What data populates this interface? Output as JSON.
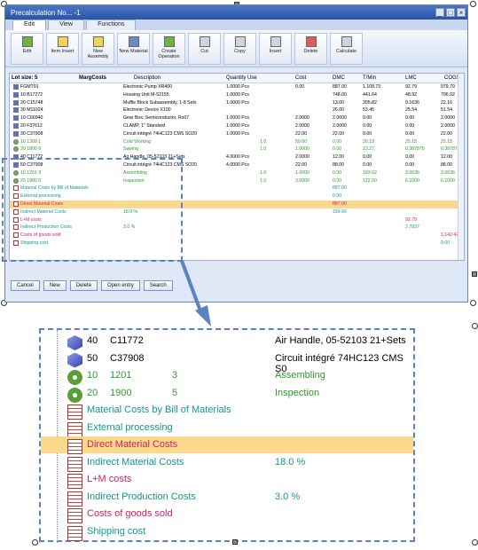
{
  "window": {
    "title": "Precalculation No... -1",
    "controls": [
      "_",
      "□",
      "×"
    ]
  },
  "tabs": [
    "Edit",
    "View",
    "Functions"
  ],
  "ribbon": [
    {
      "label": "Edit",
      "icon": "edit-icon"
    },
    {
      "label": "Item Insert",
      "icon": "item-insert-icon"
    },
    {
      "label": "New Assembly",
      "icon": "new-assembly-icon"
    },
    {
      "label": "New Material",
      "icon": "new-material-icon"
    },
    {
      "label": "Create Operation",
      "icon": "create-operation-icon"
    },
    {
      "label": "Cut",
      "icon": "cut-icon"
    },
    {
      "label": "Copy",
      "icon": "copy-icon"
    },
    {
      "label": "Insert",
      "icon": "insert-icon"
    },
    {
      "label": "Delete",
      "icon": "delete-icon"
    },
    {
      "label": "Calculate",
      "icon": "calculate-icon"
    }
  ],
  "grid": {
    "lot_size": "Lot size: 5",
    "marg_costs": "MargCosts",
    "headers": [
      "Description",
      "Quantity Use",
      "Cost",
      "DMC",
      "T/Min",
      "LMC",
      "COGS"
    ],
    "rows": [
      {
        "tree": "FGMT01",
        "desc": "Electronic Pump XR400",
        "qty": "1.0000 Pcs",
        "use": "",
        "cost": "0.00",
        "dmc": "887.00",
        "tmin": "1,108.73",
        "lmc": "92.79",
        "cogs": "979.79",
        "cls": "",
        "icon": "cube"
      },
      {
        "tree": "10  B17272",
        "desc": "Housing Unit M-52155",
        "qty": "1.0000 Pcs",
        "use": "",
        "cost": "",
        "dmc": "748.00",
        "tmin": "441.64",
        "lmc": "48.92",
        "cogs": "796.92",
        "cls": "",
        "icon": "cube"
      },
      {
        "tree": "20  C15748",
        "desc": "Muffle Block Subassembly, 1-8 Sets",
        "qty": "1.0000 Pcs",
        "use": "",
        "cost": "",
        "dmc": "13.00",
        "tmin": "305.82",
        "lmc": "9.1636",
        "cogs": "22.16",
        "cls": "",
        "icon": "cube"
      },
      {
        "tree": "30  M11024",
        "desc": "Electronic Device X100",
        "qty": "",
        "use": "",
        "cost": "",
        "dmc": "26.00",
        "tmin": "53.45",
        "lmc": "25.54",
        "cogs": "51.54",
        "cls": "",
        "icon": "cube"
      },
      {
        "tree": "10  C66940",
        "desc": "Gear Box, Semiconductor, Rx07",
        "qty": "1.0000 Pcs",
        "use": "",
        "cost": "2.0000",
        "dmc": "2.0000",
        "tmin": "0.00",
        "lmc": "0.00",
        "cogs": "2.0000",
        "cls": "",
        "icon": "cube"
      },
      {
        "tree": "20  F37612",
        "desc": "CLAMP, 1\" Standard",
        "qty": "1.0000 Pcs",
        "use": "",
        "cost": "2.0000",
        "dmc": "2.0000",
        "tmin": "0.00",
        "lmc": "0.00",
        "cogs": "2.0000",
        "cls": "",
        "icon": "cube"
      },
      {
        "tree": "30  C37908",
        "desc": "Circuit intégré 74HC123 CMS SO20",
        "qty": "1.0000 Pcs",
        "use": "",
        "cost": "22.00",
        "dmc": "22.00",
        "tmin": "0.00",
        "lmc": "0.00",
        "cogs": "22.00",
        "cls": "",
        "icon": "cube"
      },
      {
        "tree": "10  1300       1",
        "desc": "Cold Working",
        "qty": "",
        "use": "1.0",
        "cost": "50.00",
        "dmc": "0.00",
        "tmin": "30.18",
        "lmc": "25.15",
        "cogs": "25.15",
        "cls": "c-green",
        "icon": "gear"
      },
      {
        "tree": "20  1800       6",
        "desc": "Sawing",
        "qty": "",
        "use": "1.0",
        "cost": "1.0000",
        "dmc": "0.00",
        "tmin": "23.27",
        "lmc": "0.387879",
        "cogs": "0.387879",
        "cls": "c-green",
        "icon": "gear"
      },
      {
        "tree": "40  C11772",
        "desc": "Air Handle, 05-52103 21+Sets",
        "qty": "4.0000 Pcs",
        "use": "",
        "cost": "2.0000",
        "dmc": "12.00",
        "tmin": "0.00",
        "lmc": "0.00",
        "cogs": "12.00",
        "cls": "",
        "icon": "cube"
      },
      {
        "tree": "50  C37908",
        "desc": "Circuit intégré 74HC123 CMS SO20",
        "qty": "4.0000 Pcs",
        "use": "",
        "cost": "22.00",
        "dmc": "88.00",
        "tmin": "0.00",
        "lmc": "0.00",
        "cogs": "88.00",
        "cls": "",
        "icon": "cube"
      },
      {
        "tree": "10  1201       3",
        "desc": "Assembling",
        "qty": "",
        "use": "1.0",
        "cost": "1.0000",
        "dmc": "0.00",
        "tmin": "183.62",
        "lmc": "3.0636",
        "cogs": "3.0636",
        "cls": "c-green",
        "icon": "gear"
      },
      {
        "tree": "20  1900       5",
        "desc": "Inspection",
        "qty": "",
        "use": "1.0",
        "cost": "3.0000",
        "dmc": "0.00",
        "tmin": "122.00",
        "lmc": "6.1000",
        "cogs": "6.1000",
        "cls": "c-green",
        "icon": "gear"
      },
      {
        "tree": "Material Costs by Bill of Materials",
        "desc": "",
        "qty": "",
        "use": "",
        "cost": "",
        "dmc": "887.00",
        "tmin": "",
        "lmc": "",
        "cogs": "",
        "cls": "c-teal",
        "icon": "doc"
      },
      {
        "tree": "External processing",
        "desc": "",
        "qty": "",
        "use": "",
        "cost": "",
        "dmc": "0.00",
        "tmin": "",
        "lmc": "",
        "cogs": "",
        "cls": "c-teal",
        "icon": "doc"
      },
      {
        "tree": "Direct Material Costs",
        "desc": "",
        "qty": "",
        "use": "",
        "cost": "",
        "dmc": "887.00",
        "tmin": "",
        "lmc": "",
        "cogs": "",
        "cls": "c-pink",
        "icon": "doc",
        "hl": true
      },
      {
        "tree": "Indirect Material Costs",
        "desc": "18.0 %",
        "qty": "",
        "use": "",
        "cost": "",
        "dmc": "159.66",
        "tmin": "",
        "lmc": "",
        "cogs": "",
        "cls": "c-teal",
        "icon": "doc"
      },
      {
        "tree": "L+M costs",
        "desc": "",
        "qty": "",
        "use": "",
        "cost": "",
        "dmc": "",
        "tmin": "",
        "lmc": "92.79",
        "cogs": "",
        "cls": "c-pink",
        "icon": "doc"
      },
      {
        "tree": "Indirect Production Costs",
        "desc": "3.0 %",
        "qty": "",
        "use": "",
        "cost": "",
        "dmc": "",
        "tmin": "",
        "lmc": "2.7837",
        "cogs": "",
        "cls": "c-teal",
        "icon": "doc"
      },
      {
        "tree": "Costs of goods sold",
        "desc": "",
        "qty": "",
        "use": "",
        "cost": "",
        "dmc": "",
        "tmin": "",
        "lmc": "",
        "cogs": "1,142.42",
        "cls": "c-pink",
        "icon": "doc"
      },
      {
        "tree": "Shipping cost",
        "desc": "",
        "qty": "",
        "use": "",
        "cost": "",
        "dmc": "",
        "tmin": "",
        "lmc": "",
        "cogs": "0.00",
        "cls": "c-teal",
        "icon": "doc"
      }
    ]
  },
  "buttons": [
    "Cancel",
    "New",
    "Delete",
    "Open entry",
    "Search"
  ],
  "zoom": {
    "rows": [
      {
        "num": "40",
        "code": "C11772",
        "extra": "",
        "desc": "Air Handle, 05-52103 21+Sets",
        "icon": "cube",
        "cls": ""
      },
      {
        "num": "50",
        "code": "C37908",
        "extra": "",
        "desc": "Circuit intégré 74HC123 CMS S0",
        "icon": "cube",
        "cls": ""
      },
      {
        "num": "10",
        "code": "1201",
        "extra": "3",
        "desc": "Assembling",
        "icon": "gear",
        "cls": "c-green"
      },
      {
        "num": "20",
        "code": "1900",
        "extra": "5",
        "desc": "Inspection",
        "icon": "gear",
        "cls": "c-green"
      },
      {
        "label": "Material Costs by Bill of Materials",
        "value": "",
        "icon": "doc",
        "cls": "c-teal"
      },
      {
        "label": "External processing",
        "value": "",
        "icon": "doc",
        "cls": "c-teal"
      },
      {
        "label": "Direct Material Costs",
        "value": "",
        "icon": "doc",
        "cls": "c-pink",
        "hl": true
      },
      {
        "label": "Indirect Material Costs",
        "value": "18.0 %",
        "icon": "doc",
        "cls": "c-teal"
      },
      {
        "label": "L+M costs",
        "value": "",
        "icon": "doc",
        "cls": "c-pink"
      },
      {
        "label": "Indirect Production Costs",
        "value": "3.0 %",
        "icon": "doc",
        "cls": "c-teal"
      },
      {
        "label": "Costs of goods sold",
        "value": "",
        "icon": "doc",
        "cls": "c-pink"
      },
      {
        "label": "Shipping cost",
        "value": "",
        "icon": "doc",
        "cls": "c-teal"
      }
    ]
  },
  "colors": {
    "accent": "#5a82c4",
    "highlight": "#fbd98a"
  }
}
